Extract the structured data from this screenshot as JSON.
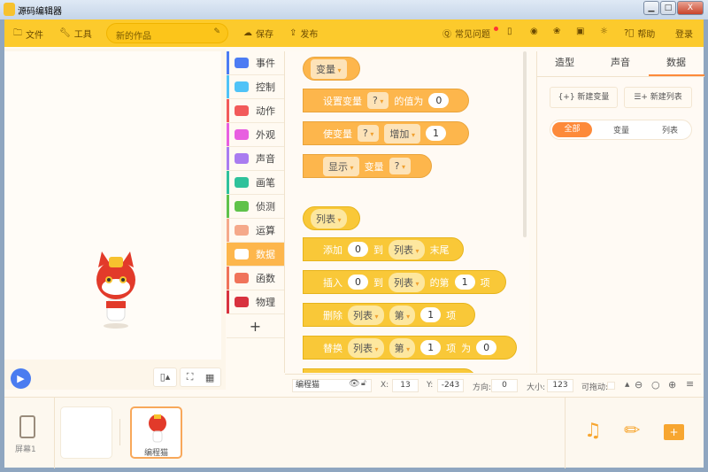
{
  "window": {
    "title": "源码编辑器",
    "min": "▁",
    "max": "□",
    "close": "X"
  },
  "toolbar": {
    "file": "文件",
    "tools": "工具",
    "project_name": "新的作品",
    "save": "保存",
    "publish": "发布",
    "faq": "常见问题",
    "help": "帮助",
    "login": "登录"
  },
  "categories": [
    {
      "label": "事件",
      "color": "#4c7cf3"
    },
    {
      "label": "控制",
      "color": "#4fc3f7"
    },
    {
      "label": "动作",
      "color": "#f25a5a"
    },
    {
      "label": "外观",
      "color": "#e85fe0"
    },
    {
      "label": "声音",
      "color": "#a97cf0"
    },
    {
      "label": "画笔",
      "color": "#2fc29b"
    },
    {
      "label": "侦测",
      "color": "#5fc24a"
    },
    {
      "label": "运算",
      "color": "#f5a98a"
    },
    {
      "label": "数据",
      "color": "#fdb64c"
    },
    {
      "label": "函数",
      "color": "#f0735a"
    },
    {
      "label": "物理",
      "color": "#d8323f"
    }
  ],
  "add_category": "+",
  "blocks": {
    "var_hat": "变量",
    "set_var": {
      "label": "设置变量",
      "var": "?",
      "mid": "的值为",
      "value": "0"
    },
    "change_var": {
      "label": "使变量",
      "var": "?",
      "op": "增加",
      "value": "1"
    },
    "show_var": {
      "action": "显示",
      "label": "变量",
      "var": "?"
    },
    "list_hat": "列表",
    "add": {
      "label": "添加",
      "value": "0",
      "to": "到",
      "list": "列表",
      "end": "末尾"
    },
    "insert": {
      "label": "插入",
      "value": "0",
      "to": "到",
      "list": "列表",
      "at": "的第",
      "index": "1",
      "item": "项"
    },
    "delete": {
      "label": "删除",
      "list": "列表",
      "which": "第",
      "index": "1",
      "item": "项"
    },
    "replace": {
      "label": "替换",
      "list": "列表",
      "which": "第",
      "index": "1",
      "item": "项",
      "as": "为",
      "value": "0"
    }
  },
  "sprite_info": {
    "name": "编程猫",
    "x_label": "X:",
    "x": "13",
    "y_label": "Y:",
    "y": "-243",
    "dir_label": "方向:",
    "dir": "0",
    "size_label": "大小:",
    "size": "123",
    "drag_label": "可拖动:"
  },
  "right_panel": {
    "tabs": [
      "造型",
      "声音",
      "数据"
    ],
    "active_tab": "数据",
    "new_var": "新建变量",
    "new_list": "新建列表",
    "filters": [
      "全部",
      "变量",
      "列表"
    ],
    "active_filter": "全部"
  },
  "bottom": {
    "screen": "屏幕1",
    "sprite": "编程猫"
  },
  "colors": {
    "accent": "#fcca2c",
    "orange": "#fd8a3a",
    "play": "#4a7cf0"
  }
}
